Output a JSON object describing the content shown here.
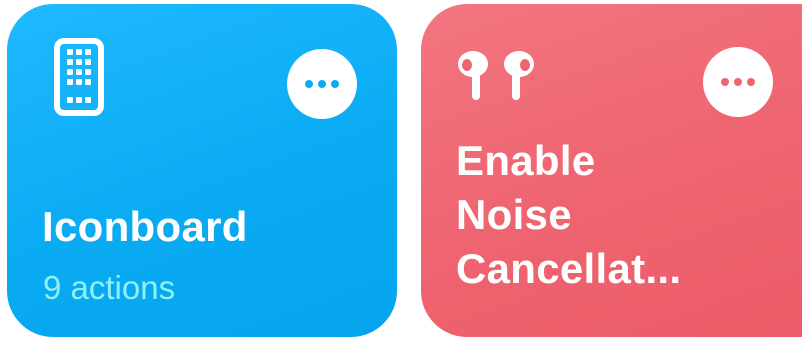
{
  "shortcuts": [
    {
      "title": "Iconboard",
      "subtitle": "9 actions",
      "icon": "phone-grid-icon",
      "color": "#0aabf3"
    },
    {
      "title_lines": [
        "Enable",
        "Noise",
        "Cancellat..."
      ],
      "icon": "airpods-pro-icon",
      "color": "#ee6470"
    }
  ]
}
